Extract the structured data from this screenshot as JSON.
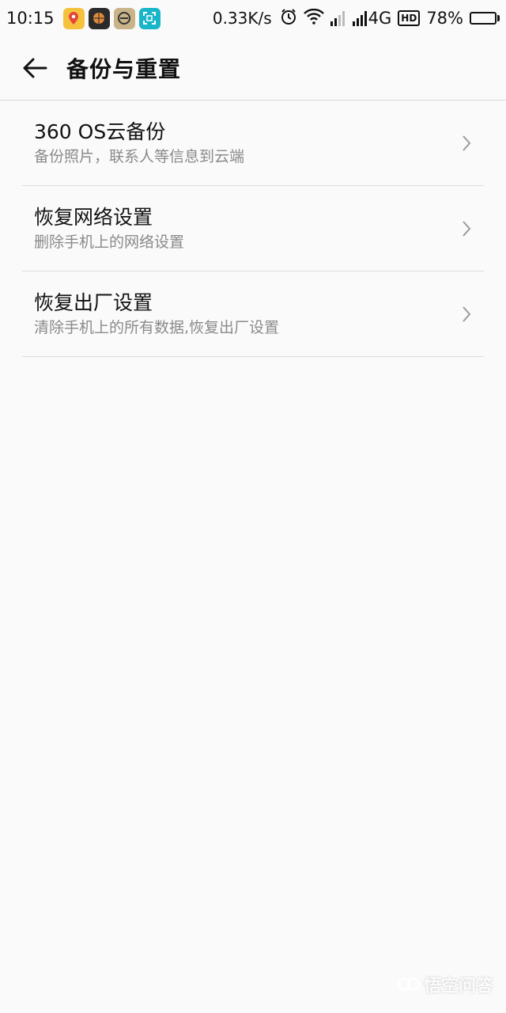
{
  "status_bar": {
    "time": "10:15",
    "net_speed": "0.33K/s",
    "network": "4G",
    "hd": "HD",
    "battery": "78%",
    "battery_level": 0.78,
    "icons": [
      "maps-icon",
      "basketball-app-icon",
      "browser-app-icon",
      "scan-app-icon",
      "alarm-icon",
      "wifi-icon",
      "signal-icon",
      "battery-icon"
    ]
  },
  "header": {
    "back_icon": "back-arrow-icon",
    "title": "备份与重置"
  },
  "list": [
    {
      "title": "360 OS云备份",
      "subtitle": "备份照片，联系人等信息到云端"
    },
    {
      "title": "恢复网络设置",
      "subtitle": "删除手机上的网络设置"
    },
    {
      "title": "恢复出厂设置",
      "subtitle": "清除手机上的所有数据,恢复出厂设置"
    }
  ],
  "watermark": {
    "text": "悟空问答"
  }
}
